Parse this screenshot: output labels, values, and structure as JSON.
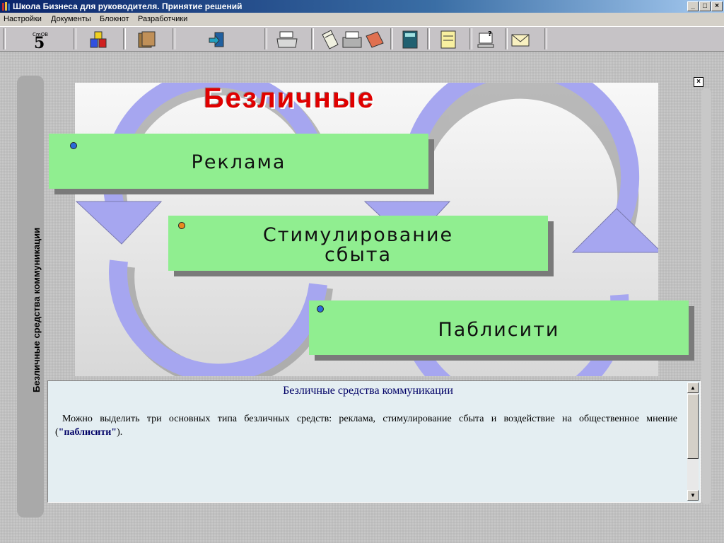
{
  "window": {
    "title": "Школа Бизнеса для руководителя. Принятие решений",
    "minimize": "_",
    "maximize": "□",
    "close": "×"
  },
  "menu": {
    "items": [
      "Настройки",
      "Документы",
      "Блокнот",
      "Разработчики"
    ]
  },
  "toolbar": {
    "buttons": [
      "logo-5-icon",
      "cubes-icon",
      "folders-icon",
      "exit-door-icon",
      "printer-icon",
      "clipboard-icon",
      "cassette-icon",
      "book-icon",
      "calculator-icon",
      "notes-icon",
      "help-computer-icon",
      "mail-icon"
    ]
  },
  "side": {
    "label": "Безличные средства коммуникации",
    "close": "×"
  },
  "diagram": {
    "title": "Безличные",
    "boxes": [
      {
        "label": "Реклама",
        "bullet_color": "#2a6bd8"
      },
      {
        "label_line1": "Стимулирование",
        "label_line2": "сбыта",
        "bullet_color": "#e88a1e"
      },
      {
        "label": "Паблисити",
        "bullet_color": "#2a6bd8"
      }
    ],
    "box_color": "#90ee90",
    "arrow_color": "#a6a6f0"
  },
  "textpanel": {
    "heading": "Безличные средства коммуникации",
    "body_before": "Можно выделить три основных типа безличных средств: реклама, стимулирование сбыта и воздействие на общественное мнение (",
    "body_bold": "\"паблисити\"",
    "body_after": ")."
  },
  "scroll": {
    "up": "▲",
    "down": "▼"
  }
}
